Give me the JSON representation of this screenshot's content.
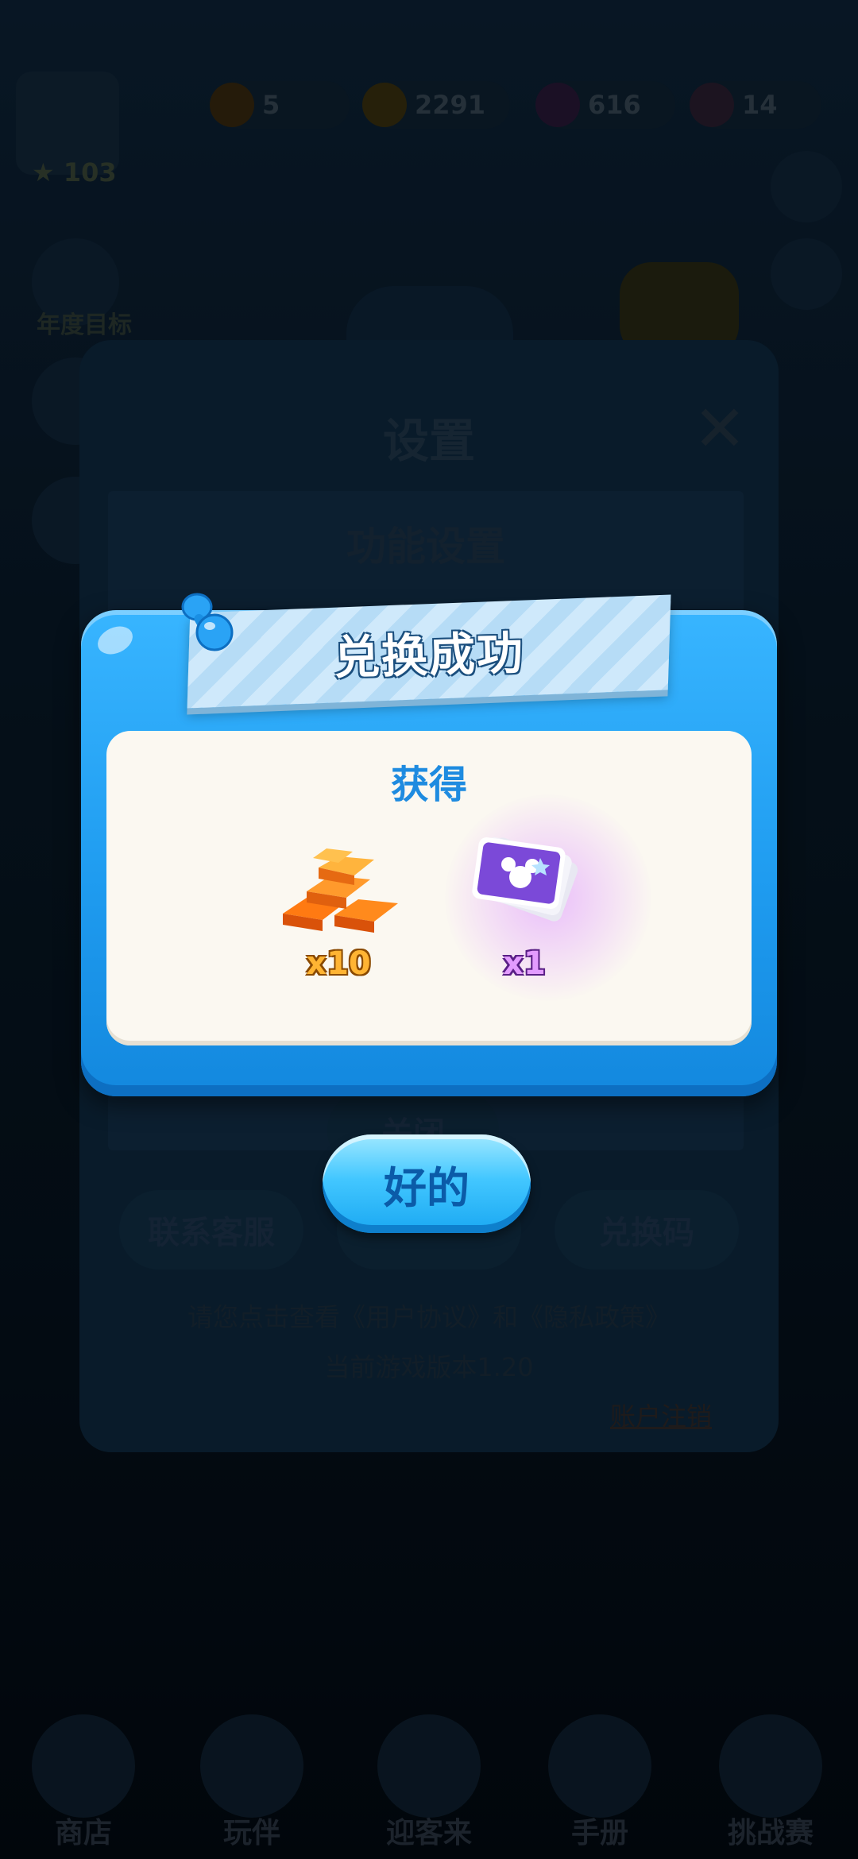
{
  "hud": {
    "res1_value": "5",
    "res1_sub": "",
    "gold_value": "2291",
    "gem_value": "616",
    "ticket_value": "14",
    "level_value": "103"
  },
  "sidebar": {
    "item1_label": "年度目标",
    "item2_label": "",
    "item3_label": ""
  },
  "settings": {
    "title": "设置",
    "section_title": "功能设置",
    "close_pill": "关闭",
    "contact_label": "联系客服",
    "redeem_label": "兑换码",
    "agreement_text": "请您点击查看《用户协议》和《隐私政策》",
    "version_text": "当前游戏版本1.20",
    "delete_account": "账户注销"
  },
  "nav": {
    "items": [
      {
        "label": "商店"
      },
      {
        "label": "玩伴"
      },
      {
        "label": "迎客来"
      },
      {
        "label": "手册"
      },
      {
        "label": "挑战赛"
      }
    ]
  },
  "modal": {
    "title": "兑换成功",
    "subtitle": "获得",
    "rewards": [
      {
        "icon": "gold-bars-icon",
        "count": "x10",
        "color": "#ff8a1c"
      },
      {
        "icon": "character-cards-icon",
        "count": "x1",
        "color": "#a25cf0"
      }
    ],
    "ok_label": "好的"
  },
  "colors": {
    "modal_blue": "#1f9cf0",
    "card_bg": "#fbf8f1",
    "title_blue": "#1e8be0"
  }
}
